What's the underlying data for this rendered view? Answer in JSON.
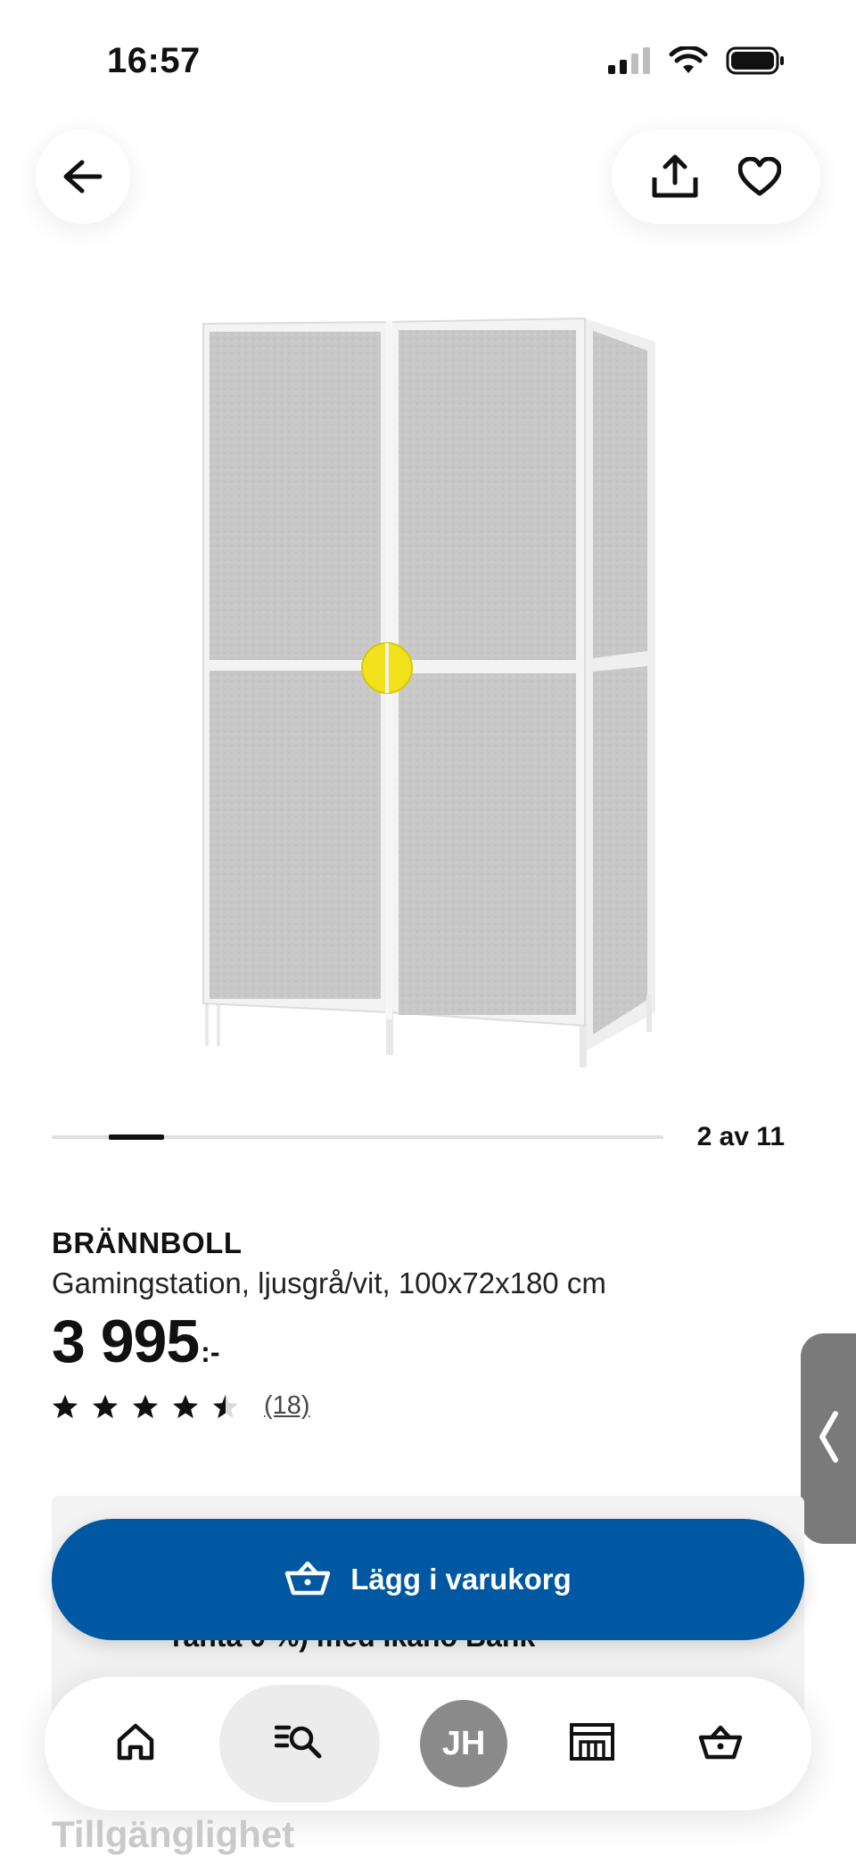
{
  "status_bar": {
    "time": "16:57"
  },
  "header": {
    "back_icon": "arrow-left-icon",
    "share_icon": "share-icon",
    "favorite_icon": "heart-icon"
  },
  "carousel": {
    "counter": "2 av 11",
    "position": 2,
    "total": 11
  },
  "product": {
    "brand": "BRÄNNBOLL",
    "description": "Gamingstation, ljusgrå/vit, 100x72x180 cm",
    "price": "3 995",
    "price_suffix": ":-",
    "rating": 4.5,
    "rating_max": 5,
    "review_count": "(18)"
  },
  "finance_teaser": "ränta 0 %) med Ikano Bank",
  "cart_button": {
    "label": "Lägg i varukorg",
    "icon": "basket-icon"
  },
  "nav": {
    "items": [
      {
        "icon": "home-icon"
      },
      {
        "icon": "search-list-icon",
        "active": true
      },
      {
        "icon": "avatar",
        "initials": "JH"
      },
      {
        "icon": "store-icon"
      },
      {
        "icon": "basket-icon"
      }
    ]
  },
  "accessibility_heading": "Tillgänglighet",
  "colors": {
    "accent": "#0058a3",
    "knob": "#f2e21b"
  }
}
